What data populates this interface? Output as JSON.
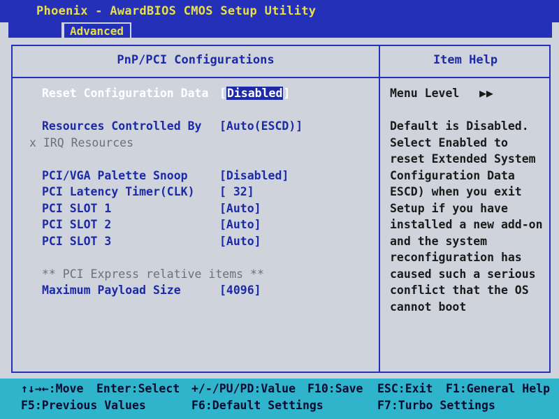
{
  "title": "Phoenix - AwardBIOS CMOS Setup Utility",
  "menu": {
    "active_tab": "Advanced"
  },
  "main": {
    "header": "PnP/PCI Configurations",
    "items": [
      {
        "label": "Reset Configuration Data",
        "value_prefix": "[",
        "value_sel": "Disabled",
        "value_suffix": "]"
      },
      {
        "label": "Resources Controlled By",
        "value": "[Auto(ESCD)]"
      },
      {
        "label": "x IRQ Resources"
      },
      {
        "label": "PCI/VGA Palette Snoop",
        "value": "[Disabled]"
      },
      {
        "label": "PCI Latency Timer(CLK)",
        "value": "[ 32]"
      },
      {
        "label": "PCI SLOT 1",
        "value": "[Auto]"
      },
      {
        "label": "PCI SLOT 2",
        "value": "[Auto]"
      },
      {
        "label": "PCI SLOT 3",
        "value": "[Auto]"
      },
      {
        "label": "** PCI Express relative items **"
      },
      {
        "label": "Maximum Payload Size",
        "value": "[4096]"
      }
    ]
  },
  "help": {
    "header": "Item Help",
    "menu_level_label": "Menu Level",
    "menu_level_arrows": "▶▶",
    "lines": [
      "Default is Disabled.",
      "Select Enabled to",
      "reset Extended System",
      "Configuration Data",
      "ESCD) when you exit",
      "Setup if you have",
      "installed a new add-on",
      "and the system",
      "reconfiguration has",
      "caused such a serious",
      "conflict that the OS",
      "cannot boot"
    ]
  },
  "footer": {
    "move": "↑↓→←:Move",
    "enter": "Enter:Select",
    "value": "+/-/PU/PD:Value",
    "f10": "F10:Save",
    "esc": "ESC:Exit",
    "f1": "F1:General Help",
    "f5": "F5:Previous Values",
    "f6": "F6:Default Settings",
    "f7": "F7:Turbo Settings"
  },
  "colors": {
    "title_bar": "#2430b8",
    "title_text": "#e8e048",
    "item_blue": "#1c2aa8",
    "footer_bg": "#2fb4cc",
    "panel_bg": "#cfd3dc"
  }
}
